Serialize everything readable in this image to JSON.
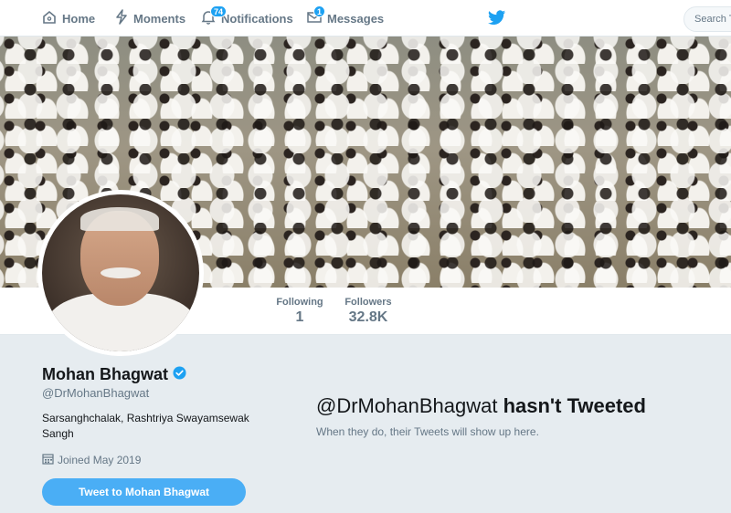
{
  "nav": {
    "home": "Home",
    "moments": "Moments",
    "notifications": "Notifications",
    "notifications_badge": "74",
    "messages": "Messages",
    "messages_badge": "1",
    "search_placeholder": "Search Tw"
  },
  "colors": {
    "accent": "#1da1f2",
    "button": "#4aaef5",
    "muted_text": "#657786",
    "background": "#e6ecf0"
  },
  "icons": [
    "home-icon",
    "lightning-icon",
    "bell-icon",
    "envelope-icon",
    "twitter-bird-icon",
    "verified-icon",
    "calendar-icon"
  ],
  "stats": {
    "following_label": "Following",
    "following_value": "1",
    "followers_label": "Followers",
    "followers_value": "32.8K"
  },
  "profile": {
    "name": "Mohan Bhagwat",
    "handle": "@DrMohanBhagwat",
    "bio": "Sarsanghchalak, Rashtriya Swayamsewak Sangh",
    "joined": "Joined May 2019",
    "tweet_button": "Tweet to Mohan Bhagwat"
  },
  "empty_state": {
    "title_handle": "@DrMohanBhagwat",
    "title_rest": "hasn't Tweeted",
    "subtitle": "When they do, their Tweets will show up here."
  }
}
